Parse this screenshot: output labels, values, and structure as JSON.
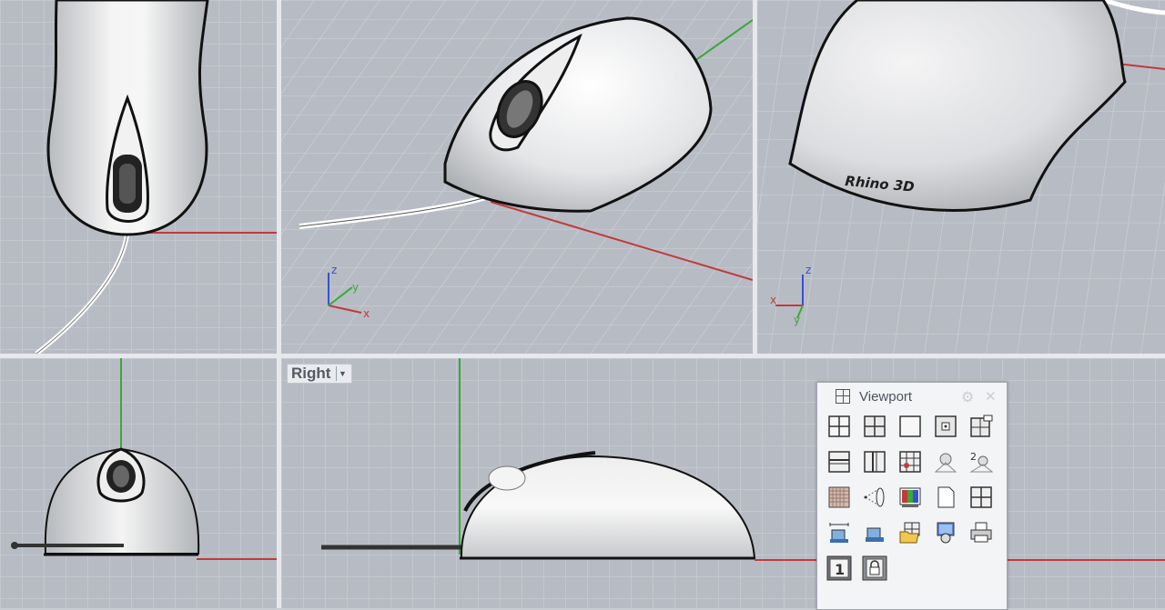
{
  "viewports": {
    "bottom_center": {
      "title": "Right"
    }
  },
  "model_label": "Rhino 3D",
  "axis_labels": {
    "x": "x",
    "y": "y",
    "z": "z"
  },
  "viewport_panel": {
    "title": "Viewport",
    "buttons": [
      {
        "icon": "four-viewports-icon"
      },
      {
        "icon": "split-viewport-icon"
      },
      {
        "icon": "single-viewport-icon"
      },
      {
        "icon": "center-viewport-icon"
      },
      {
        "icon": "viewport-properties-icon"
      },
      {
        "icon": "split-horizontal-icon"
      },
      {
        "icon": "split-vertical-icon"
      },
      {
        "icon": "grid-layout-icon"
      },
      {
        "icon": "camera-target-icon"
      },
      {
        "icon": "two-point-perspective-icon"
      },
      {
        "icon": "grid-snap-icon"
      },
      {
        "icon": "lens-length-icon"
      },
      {
        "icon": "color-display-icon"
      },
      {
        "icon": "layout-page-icon"
      },
      {
        "icon": "tile-viewports-icon"
      },
      {
        "icon": "set-cplane-icon"
      },
      {
        "icon": "cplane-origin-icon"
      },
      {
        "icon": "open-folder-icon"
      },
      {
        "icon": "capture-viewport-icon"
      },
      {
        "icon": "print-icon"
      },
      {
        "icon": "viewport-number-icon",
        "label": "1"
      },
      {
        "icon": "lock-icon"
      }
    ]
  },
  "colors": {
    "viewport_bg": "#b7bcc4",
    "grid_line": "#cfd3d9",
    "x_axis": "#c23a3a",
    "y_axis": "#3aa83a",
    "z_axis": "#3a4fd0"
  }
}
